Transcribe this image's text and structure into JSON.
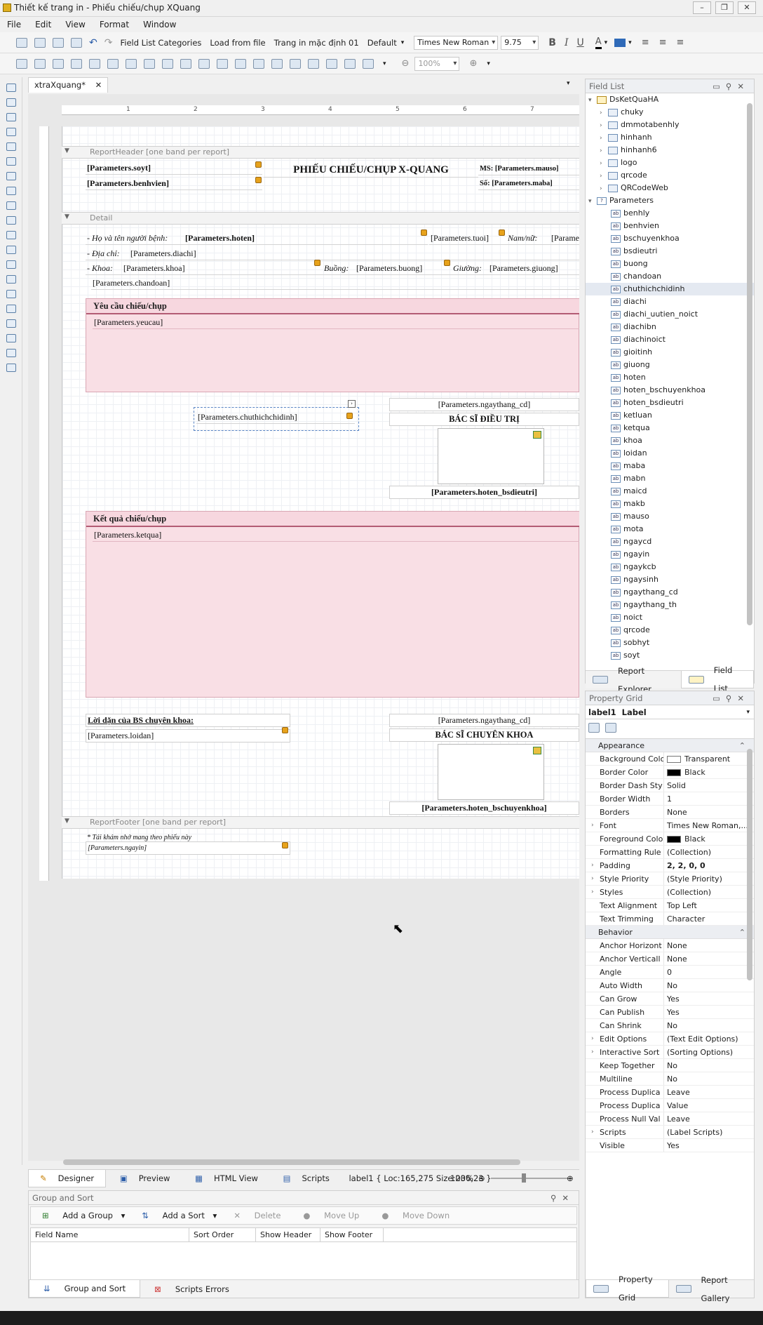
{
  "window": {
    "title": "Thiết kế trang in - Phiếu chiếu/chụp XQuang"
  },
  "menu": [
    "File",
    "Edit",
    "View",
    "Format",
    "Window"
  ],
  "toolbar": {
    "field_list_categories": "Field List Categories",
    "load_from_file": "Load from file",
    "default_page": "Trang in mặc định 01",
    "style_combo": "Default",
    "font_name": "Times New Roman",
    "font_size": "9.75",
    "zoom_combo": "100%"
  },
  "document_tab": "xtraXquang*",
  "ruler_marks": [
    "1",
    "2",
    "3",
    "4",
    "5",
    "6",
    "7"
  ],
  "bands": {
    "report_header": "ReportHeader [one band per report]",
    "detail": "Detail",
    "report_footer": "ReportFooter [one band per report]"
  },
  "report": {
    "soyt": "[Parameters.soyt]",
    "benhvien": "[Parameters.benhvien]",
    "title": "PHIẾU CHIẾU/CHỤP X-QUANG",
    "ms": "MS: [Parameters.mauso]",
    "so": "Số: [Parameters.maba]",
    "hoten_label": "- Họ và tên người bệnh:",
    "hoten": "[Parameters.hoten]",
    "tuoi": "[Parameters.tuoi]",
    "nam_nu": "Nam/nữ:",
    "gioitinh": "[Parame",
    "diachi_label": "- Địa chỉ:",
    "diachi": "[Parameters.diachi]",
    "khoa_label": "- Khoa:",
    "khoa": "[Parameters.khoa]",
    "buong_label": "Buồng:",
    "buong": "[Parameters.buong]",
    "giuong_label": "Giường:",
    "giuong": "[Parameters.giuong]",
    "chandoan": "[Parameters.chandoan]",
    "yeucau_head": "Yêu cầu chiếu/chụp",
    "yeucau": "[Parameters.yeucau]",
    "chuthich": "[Parameters.chuthichchidinh]",
    "ngaythang_cd": "[Parameters.ngaythang_cd]",
    "bs_dieutri": "BÁC SĨ ĐIỀU TRỊ",
    "hoten_bsdieutri": "[Parameters.hoten_bsdieutri]",
    "ketqua_head": "Kết quả chiếu/chụp",
    "ketqua": "[Parameters.ketqua]",
    "loidan_head": "Lời dặn của BS chuyên khoa:",
    "loidan": "[Parameters.loidan]",
    "ngaythang_cd2": "[Parameters.ngaythang_cd]",
    "bs_chuyenkhoa": "BÁC SĨ CHUYÊN KHOA",
    "hoten_bschuyenkhoa": "[Parameters.hoten_bschuyenkhoa]",
    "footer_note": "* Tái khám nhớ mang theo phiếu này",
    "ngayin": "[Parameters.ngayin]"
  },
  "field_list": {
    "title": "Field List",
    "root": "DsKetQuaHA",
    "tables": [
      "chuky",
      "dmmotabenhly",
      "hinhanh",
      "hinhanh6",
      "logo",
      "qrcode",
      "QRCodeWeb"
    ],
    "params_label": "Parameters",
    "params": [
      "benhly",
      "benhvien",
      "bschuyenkhoa",
      "bsdieutri",
      "buong",
      "chandoan",
      "chuthichchidinh",
      "diachi",
      "diachi_uutien_noict",
      "diachibn",
      "diachinoict",
      "gioitinh",
      "giuong",
      "hoten",
      "hoten_bschuyenkhoa",
      "hoten_bsdieutri",
      "ketluan",
      "ketqua",
      "khoa",
      "loidan",
      "maba",
      "mabn",
      "maicd",
      "makb",
      "mauso",
      "mota",
      "ngaycd",
      "ngayin",
      "ngaykcb",
      "ngaysinh",
      "ngaythang_cd",
      "ngaythang_th",
      "noict",
      "qrcode",
      "sobhyt",
      "soyt"
    ],
    "selected": "chuthichchidinh",
    "tabs": [
      "Report Explorer",
      "Field List"
    ]
  },
  "property_grid": {
    "title": "Property Grid",
    "selector": "label1  Label",
    "appearance_label": "Appearance",
    "appearance": [
      {
        "k": "Background Colo",
        "v": "Transparent",
        "swatch": "#ffffff"
      },
      {
        "k": "Border Color",
        "v": "Black",
        "swatch": "#000000"
      },
      {
        "k": "Border Dash Sty",
        "v": "Solid"
      },
      {
        "k": "Border Width",
        "v": "1"
      },
      {
        "k": "Borders",
        "v": "None"
      },
      {
        "k": "Font",
        "v": "Times New Roman,...",
        "exp": true
      },
      {
        "k": "Foreground Colo",
        "v": "Black",
        "swatch": "#000000"
      },
      {
        "k": "Formatting Rule",
        "v": "(Collection)"
      },
      {
        "k": "Padding",
        "v": "2, 2, 0, 0",
        "exp": true,
        "bold": true
      },
      {
        "k": "Style Priority",
        "v": "(Style Priority)",
        "exp": true
      },
      {
        "k": "Styles",
        "v": "(Collection)",
        "exp": true
      },
      {
        "k": "Text Alignment",
        "v": "Top Left"
      },
      {
        "k": "Text Trimming",
        "v": "Character"
      }
    ],
    "behavior_label": "Behavior",
    "behavior": [
      {
        "k": "Anchor Horizont",
        "v": "None"
      },
      {
        "k": "Anchor Verticall",
        "v": "None"
      },
      {
        "k": "Angle",
        "v": "0"
      },
      {
        "k": "Auto Width",
        "v": "No"
      },
      {
        "k": "Can Grow",
        "v": "Yes"
      },
      {
        "k": "Can Publish",
        "v": "Yes"
      },
      {
        "k": "Can Shrink",
        "v": "No"
      },
      {
        "k": "Edit Options",
        "v": "(Text Edit Options)",
        "exp": true
      },
      {
        "k": "Interactive Sort",
        "v": "(Sorting Options)",
        "exp": true
      },
      {
        "k": "Keep Together",
        "v": "No"
      },
      {
        "k": "Multiline",
        "v": "No"
      },
      {
        "k": "Process Duplica",
        "v": "Leave"
      },
      {
        "k": "Process Duplica",
        "v": "Value"
      },
      {
        "k": "Process Null Val",
        "v": "Leave"
      },
      {
        "k": "Scripts",
        "v": "(Label Scripts)",
        "exp": true
      },
      {
        "k": "Visible",
        "v": "Yes"
      }
    ],
    "tabs": [
      "Property Grid",
      "Report Gallery"
    ]
  },
  "status": {
    "tabs": [
      "Designer",
      "Preview",
      "HTML View",
      "Scripts"
    ],
    "info": "label1 { Loc:165,275 Size:236,23 }",
    "zoom": "100%"
  },
  "group_sort": {
    "title": "Group and Sort",
    "add_group": "Add a Group",
    "add_sort": "Add a Sort",
    "delete": "Delete",
    "move_up": "Move Up",
    "move_down": "Move Down",
    "columns": [
      "Field Name",
      "Sort Order",
      "Show Header",
      "Show Footer"
    ],
    "tabs": [
      "Group and Sort",
      "Scripts Errors"
    ]
  }
}
